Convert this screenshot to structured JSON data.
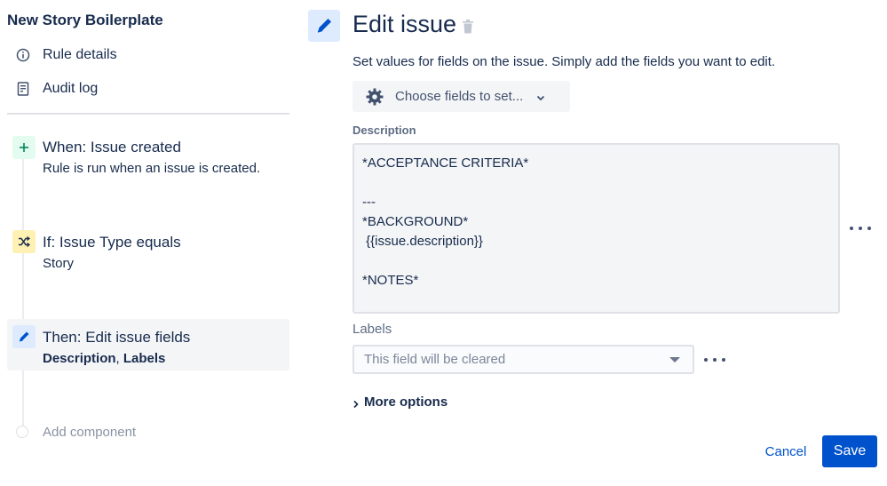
{
  "sidebar": {
    "rule_title": "New Story Boilerplate",
    "nav": [
      {
        "label": "Rule details",
        "icon": "info-icon"
      },
      {
        "label": "Audit log",
        "icon": "document-icon"
      }
    ],
    "steps": [
      {
        "title": "When: Issue created",
        "subtitle": "Rule is run when an issue is created.",
        "icon": "plus-icon",
        "color": "#e3fcef"
      },
      {
        "title": "If: Issue Type equals",
        "subtitle": "Story",
        "icon": "shuffle-icon",
        "color": "#fff0b3"
      },
      {
        "title": "Then: Edit issue fields",
        "subtitle_bold_1": "Description",
        "subtitle_sep": ", ",
        "subtitle_bold_2": "Labels",
        "icon": "pencil-icon",
        "color": "#deebff"
      }
    ],
    "add_component": "Add component"
  },
  "editor": {
    "title": "Edit issue",
    "description": "Set values for fields on the issue. Simply add the fields you want to edit.",
    "choose_fields": "Choose fields to set...",
    "description_label": "Description",
    "description_lines": [
      "*ACCEPTANCE CRITERIA*",
      "",
      "---",
      "*BACKGROUND*",
      " {{issue.description}}",
      "",
      "*NOTES*"
    ],
    "labels_label": "Labels",
    "labels_placeholder": "This field will be cleared",
    "more_options": "More options",
    "cancel": "Cancel",
    "save": "Save"
  },
  "colors": {
    "primary": "#0052cc",
    "text": "#172b4d",
    "subtle": "#5e6c84",
    "selected_bg": "#f4f5f7"
  }
}
